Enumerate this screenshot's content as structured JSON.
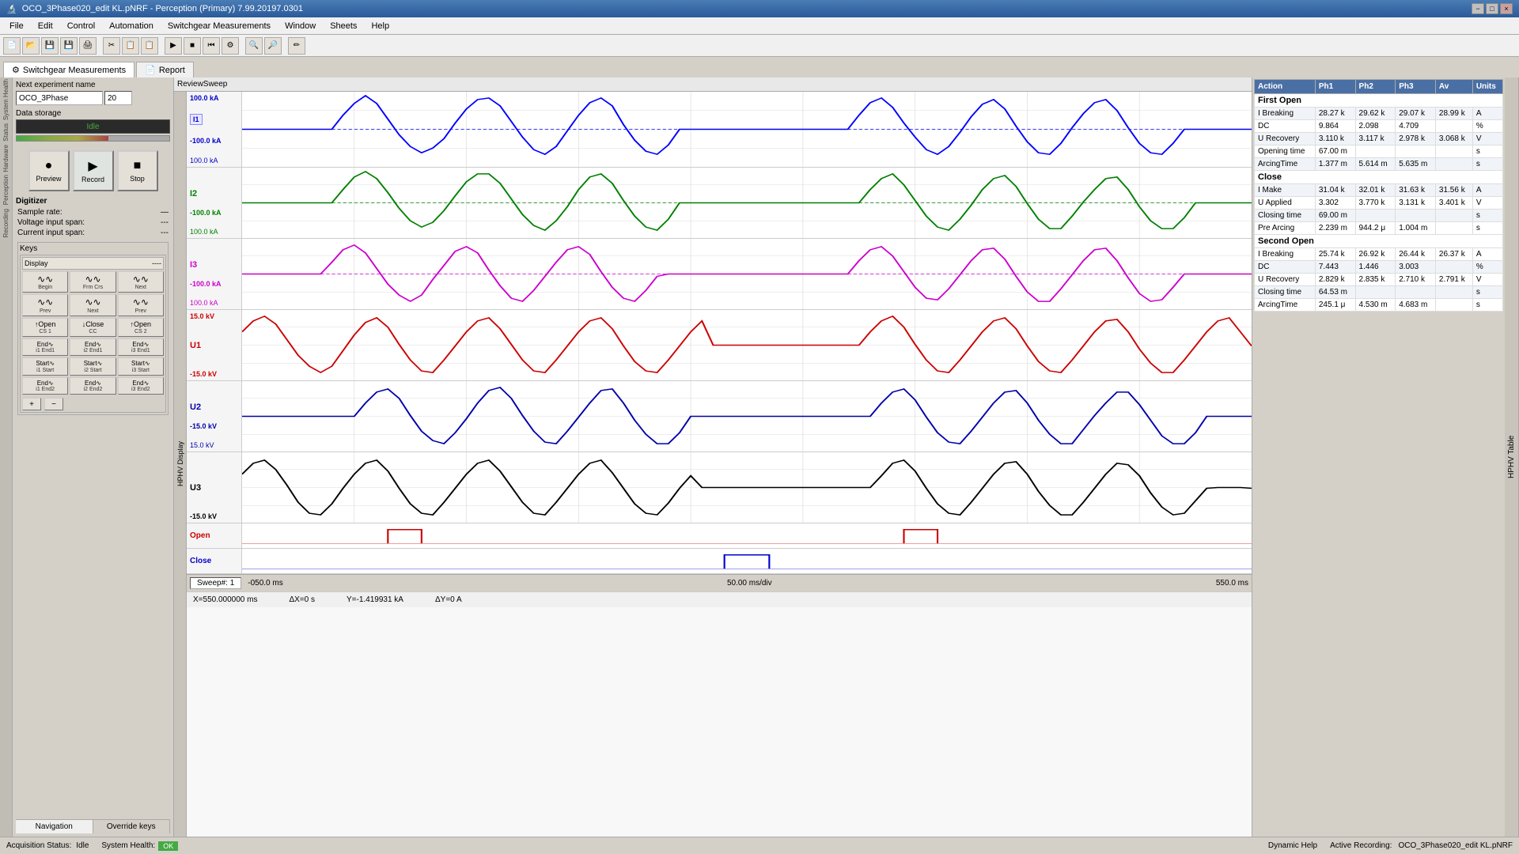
{
  "titlebar": {
    "title": "OCO_3Phase020_edit KL.pNRF - Perception (Primary) 7.99.20197.0301",
    "min": "−",
    "max": "□",
    "close": "×"
  },
  "menubar": {
    "items": [
      "File",
      "Edit",
      "Control",
      "Automation",
      "Switchgear Measurements",
      "Window",
      "Sheets",
      "Help"
    ]
  },
  "tabs": [
    {
      "label": "Switchgear Measurements",
      "icon": "⚙"
    },
    {
      "label": "Report",
      "icon": "📄"
    }
  ],
  "left_panel": {
    "next_experiment_label": "Next experiment name",
    "experiment_name": "OCO_3Phase",
    "experiment_num": "20",
    "data_storage_label": "Data storage",
    "status": "Idle",
    "preview_label": "Preview",
    "record_label": "Record",
    "stop_label": "Stop",
    "digitizer_label": "Digitizer",
    "sample_rate_label": "Sample rate:",
    "sample_rate_val": "—",
    "voltage_span_label": "Voltage input span:",
    "voltage_span_val": "---",
    "current_span_label": "Current input span:",
    "current_span_val": "---",
    "keys_label": "Keys",
    "display_label": "Display",
    "display_val": "----",
    "nav_tab1": "Navigation",
    "nav_tab2": "Override keys"
  },
  "key_buttons": [
    {
      "icon": "∿∿",
      "label": "Begin"
    },
    {
      "icon": "∿∿",
      "label": "Frm Crs"
    },
    {
      "icon": "∿∿",
      "label": "Next"
    },
    {
      "icon": "∿∿",
      "label": "Prev"
    },
    {
      "icon": "∿∿",
      "label": "Next"
    },
    {
      "icon": "∿∿",
      "label": "Prev"
    },
    {
      "icon": "↑Open",
      "label": "CS 1"
    },
    {
      "icon": "↓Close",
      "label": "CC"
    },
    {
      "icon": "↑Open",
      "label": "CS 2"
    },
    {
      "icon": "End∿",
      "label": "i1 End1"
    },
    {
      "icon": "End∿",
      "label": "i2 End1"
    },
    {
      "icon": "End∿",
      "label": "i3 End1"
    },
    {
      "icon": "Start∿",
      "label": "i1 Start"
    },
    {
      "icon": "Start∿",
      "label": "i2 Start"
    },
    {
      "icon": "Start∿",
      "label": "i3 Start"
    },
    {
      "icon": "End∿",
      "label": "i1 End2"
    },
    {
      "icon": "End∿",
      "label": "i2 End2"
    },
    {
      "icon": "End∿",
      "label": "i3 End2"
    }
  ],
  "waveform": {
    "sweep_label": "ReviewSweep",
    "channels": [
      {
        "name": "I1",
        "top_val": "100.0 kA",
        "bot_val": "-100.0 kA",
        "mid2": "100.0 kA",
        "color": "#0000ff"
      },
      {
        "name": "I2",
        "top_val": "",
        "bot_val": "-100.0 kA",
        "mid2": "100.0 kA",
        "color": "#008000"
      },
      {
        "name": "I3",
        "top_val": "",
        "bot_val": "-100.0 kA",
        "mid2": "100.0 kA",
        "color": "#cc00cc"
      },
      {
        "name": "U1",
        "top_val": "15.0 kV",
        "bot_val": "-15.0 kV",
        "mid2": "15.0 kV",
        "color": "#cc0000"
      },
      {
        "name": "U2",
        "top_val": "",
        "bot_val": "-15.0 kV",
        "mid2": "15.0 kV",
        "color": "#0000aa"
      },
      {
        "name": "U3",
        "top_val": "",
        "bot_val": "-15.0 kV",
        "mid2": "15.0 kV",
        "color": "#000000"
      },
      {
        "name": "Open",
        "color": "#cc0000",
        "digital": true
      },
      {
        "name": "Close",
        "color": "#0000cc",
        "digital": true
      }
    ],
    "sweep_num": "Sweep#: 1",
    "time_start": "-050.0 ms",
    "time_scale": "50.00 ms/div",
    "time_end": "550.0 ms",
    "cursor_x": "X=550.000000 ms",
    "delta_x": "ΔX=0 s",
    "cursor_y": "Y=-1.419931 kA",
    "delta_y": "ΔY=0 A"
  },
  "hphv_table": {
    "title": "HPHV Table",
    "columns": [
      "Action",
      "Ph1",
      "Ph2",
      "Ph3",
      "Av",
      "Units"
    ],
    "sections": [
      {
        "name": "First Open",
        "rows": [
          {
            "action": "I Breaking",
            "ph1": "28.27 k",
            "ph2": "29.62 k",
            "ph3": "29.07 k",
            "av": "28.99 k",
            "units": "A"
          },
          {
            "action": "DC",
            "ph1": "9.864",
            "ph2": "2.098",
            "ph3": "4.709",
            "av": "",
            "units": "%"
          },
          {
            "action": "U Recovery",
            "ph1": "3.110 k",
            "ph2": "3.117 k",
            "ph3": "2.978 k",
            "av": "3.068 k",
            "units": "V"
          },
          {
            "action": "Opening time",
            "ph1": "67.00 m",
            "ph2": "",
            "ph3": "",
            "av": "",
            "units": "s"
          },
          {
            "action": "ArcingTime",
            "ph1": "1.377 m",
            "ph2": "5.614 m",
            "ph3": "5.635 m",
            "av": "",
            "units": "s"
          }
        ]
      },
      {
        "name": "Close",
        "rows": [
          {
            "action": "I Make",
            "ph1": "31.04 k",
            "ph2": "32.01 k",
            "ph3": "31.63 k",
            "av": "31.56 k",
            "units": "A"
          },
          {
            "action": "U Applied",
            "ph1": "3.302",
            "ph2": "3.770 k",
            "ph3": "3.131 k",
            "av": "3.401 k",
            "units": "V"
          },
          {
            "action": "Closing time",
            "ph1": "69.00 m",
            "ph2": "",
            "ph3": "",
            "av": "",
            "units": "s"
          },
          {
            "action": "Pre Arcing",
            "ph1": "2.239 m",
            "ph2": "944.2 μ",
            "ph3": "1.004 m",
            "av": "",
            "units": "s"
          }
        ]
      },
      {
        "name": "Second Open",
        "rows": [
          {
            "action": "I Breaking",
            "ph1": "25.74 k",
            "ph2": "26.92 k",
            "ph3": "26.44 k",
            "av": "26.37 k",
            "units": "A"
          },
          {
            "action": "DC",
            "ph1": "7.443",
            "ph2": "1.446",
            "ph3": "3.003",
            "av": "",
            "units": "%"
          },
          {
            "action": "U Recovery",
            "ph1": "2.829 k",
            "ph2": "2.835 k",
            "ph3": "2.710 k",
            "av": "2.791 k",
            "units": "V"
          },
          {
            "action": "Closing time",
            "ph1": "64.53 m",
            "ph2": "",
            "ph3": "",
            "av": "",
            "units": "s"
          },
          {
            "action": "ArcingTime",
            "ph1": "245.1 μ",
            "ph2": "4.530 m",
            "ph3": "4.683 m",
            "av": "",
            "units": "s"
          }
        ]
      }
    ]
  },
  "statusbar": {
    "acquisition": "Acquisition Status:",
    "acq_status": "Idle",
    "health": "System Health:",
    "health_status": "OK",
    "dynamic_help": "Dynamic Help",
    "active_recording": "Active Recording:",
    "recording_file": "OCO_3Phase020_edit KL.pNRF"
  }
}
